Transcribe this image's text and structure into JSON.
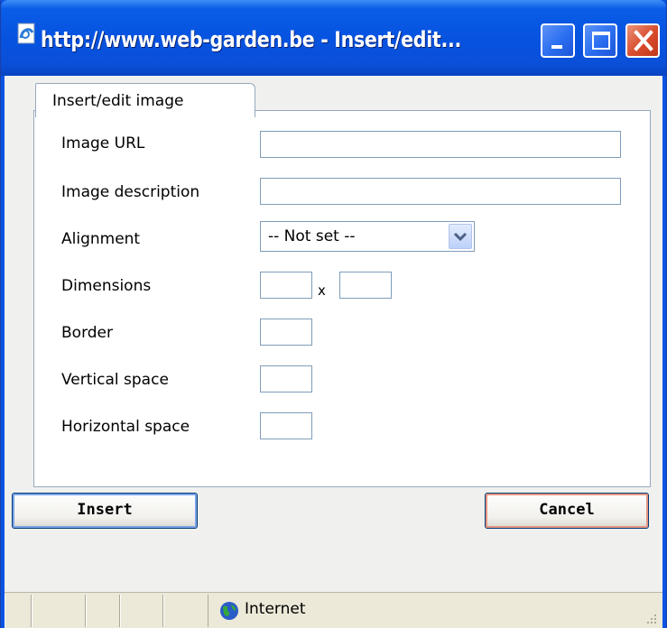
{
  "window": {
    "title": "http://www.web-garden.be - Insert/edit...",
    "title_color": "#ffffff",
    "titlebar_color": "#0653e0",
    "close_color": "#d94a2b"
  },
  "tabs": [
    {
      "label": "Insert/edit image"
    }
  ],
  "form": {
    "image_url_label": "Image URL",
    "image_url_value": "",
    "image_description_label": "Image description",
    "image_description_value": "",
    "alignment_label": "Alignment",
    "alignment_selected": "-- Not set --",
    "dimensions_label": "Dimensions",
    "dimensions_separator": "x",
    "width_value": "",
    "height_value": "",
    "border_label": "Border",
    "border_value": "",
    "vertical_space_label": "Vertical space",
    "vertical_space_value": "",
    "horizontal_space_label": "Horizontal space",
    "horizontal_space_value": ""
  },
  "buttons": {
    "insert_label": "Insert",
    "cancel_label": "Cancel"
  },
  "statusbar": {
    "zone_icon": "globe-icon",
    "zone_text": "Internet"
  }
}
